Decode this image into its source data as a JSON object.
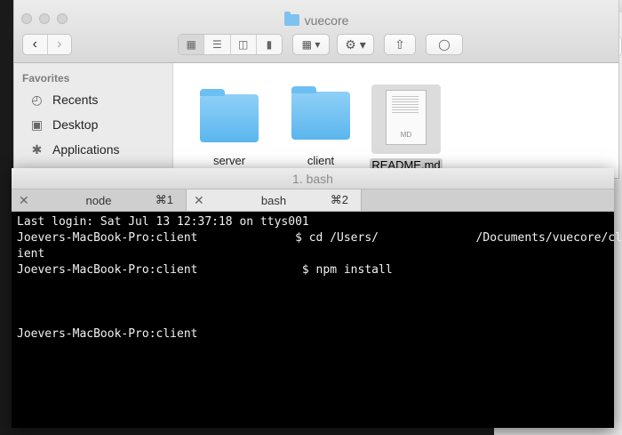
{
  "finder": {
    "title": "vuecore",
    "sidebar": {
      "header": "Favorites",
      "items": [
        {
          "label": "Recents",
          "icon": "recents-icon"
        },
        {
          "label": "Desktop",
          "icon": "desktop-icon"
        },
        {
          "label": "Applications",
          "icon": "applications-icon"
        }
      ]
    },
    "files": [
      {
        "name": "server",
        "icon": "folder-icon"
      },
      {
        "name": "client",
        "icon": "folder-icon"
      },
      {
        "name": "README.md",
        "icon": "markdown-file-icon",
        "badge": "MD",
        "selected": true
      }
    ]
  },
  "terminal": {
    "title": "1. bash",
    "tabs": [
      {
        "label": "node",
        "shortcut": "⌘1",
        "active": false
      },
      {
        "label": "bash",
        "shortcut": "⌘2",
        "active": true
      }
    ],
    "lines": [
      "Last login: Sat Jul 13 12:37:18 on ttys001",
      "Joevers-MacBook-Pro:client              ​$ cd /Users/              /Documents/vuecore/cl",
      "ient",
      "Joevers-MacBook-Pro:client               $ npm install",
      "",
      "",
      "",
      "Joevers-MacBook-Pro:client"
    ]
  }
}
